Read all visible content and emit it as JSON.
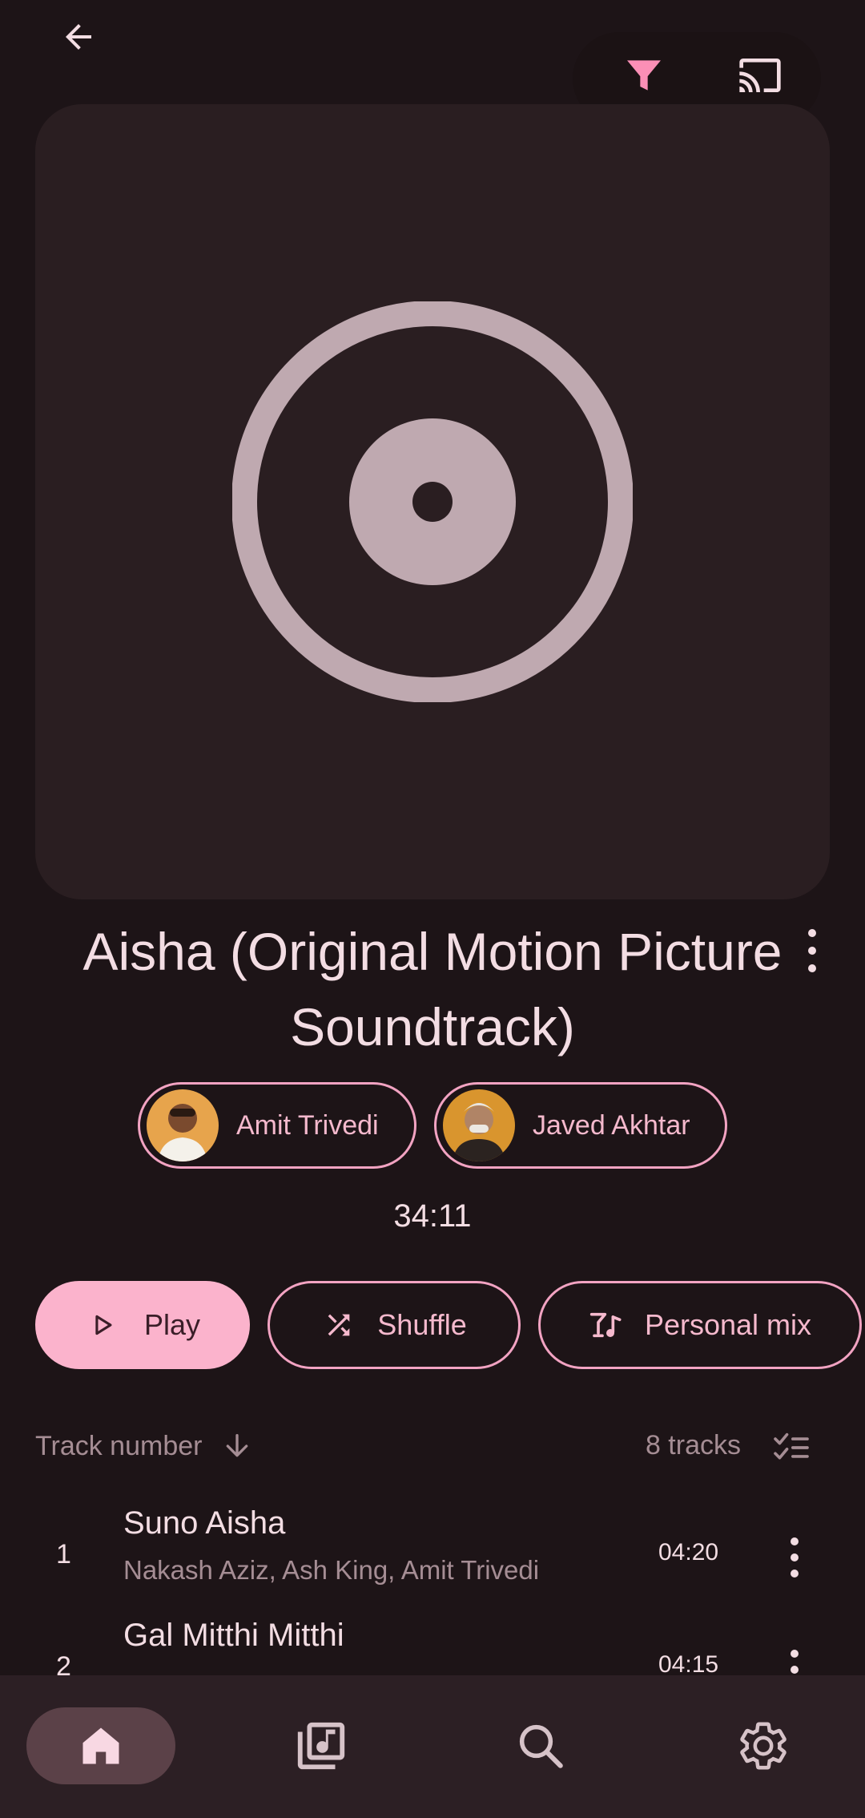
{
  "header": {
    "back_icon": "arrow-back-icon",
    "filter_icon": "filter-icon",
    "cast_icon": "cast-icon"
  },
  "album": {
    "art_icon": "disc-icon",
    "title": "Aisha (Original Motion Picture Soundtrack)",
    "artists": [
      {
        "name": "Amit Trivedi"
      },
      {
        "name": "Javed Akhtar"
      }
    ],
    "duration": "34:11"
  },
  "actions": {
    "play_label": "Play",
    "shuffle_label": "Shuffle",
    "mix_label": "Personal mix"
  },
  "sort": {
    "label": "Track number",
    "count": "8 tracks"
  },
  "tracks": [
    {
      "number": "1",
      "title": "Suno Aisha",
      "artists": "Nakash Aziz, Ash King, Amit Trivedi",
      "duration": "04:20"
    },
    {
      "number": "2",
      "title": "Gal Mitthi Mitthi",
      "artists": "",
      "duration": "04:15"
    }
  ],
  "nav": {
    "items": [
      "home-icon",
      "library-icon",
      "search-icon",
      "settings-icon"
    ]
  },
  "colors": {
    "background": "#1d1417",
    "accent": "#fbb3cc",
    "outline": "#f2a3c2",
    "card": "#2a1e21"
  }
}
